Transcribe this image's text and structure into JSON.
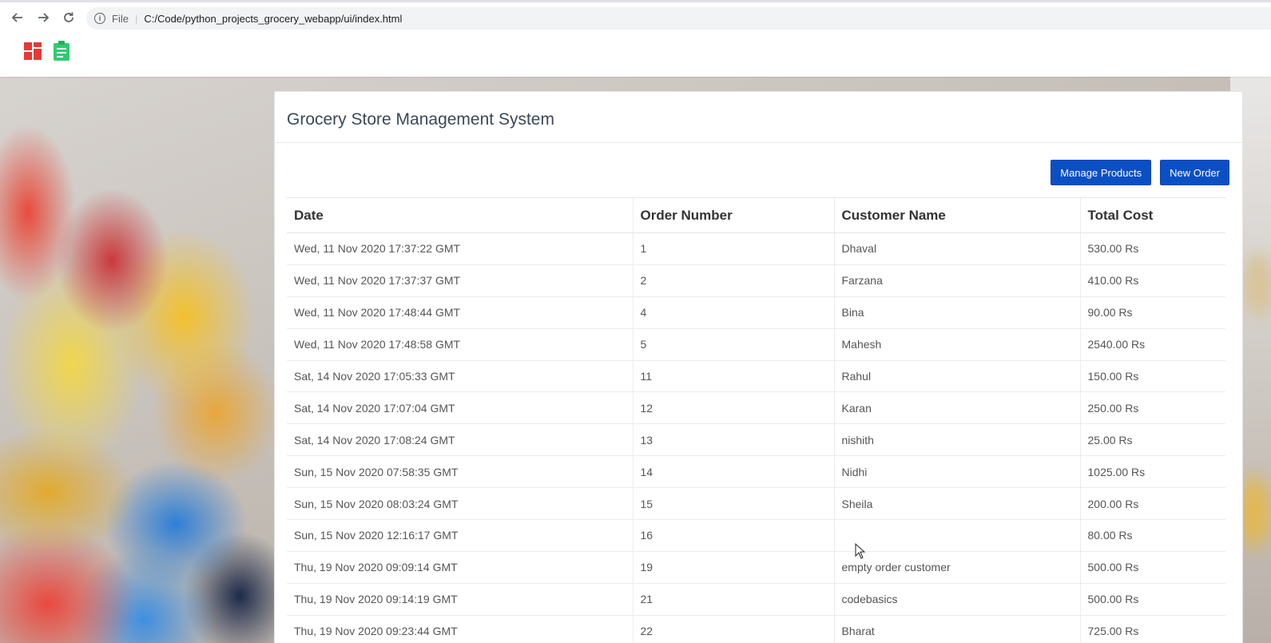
{
  "browser": {
    "scheme": "File",
    "url": "C:/Code/python_projects_grocery_webapp/ui/index.html"
  },
  "app": {
    "title": "Grocery Store Management System",
    "icons": [
      "dashboard-icon",
      "clipboard-icon"
    ],
    "colors": {
      "primary_button": "#0b4fc5",
      "dashboard_icon": "#e53935",
      "clipboard_icon": "#2ecc71"
    }
  },
  "actions": {
    "manage_products": "Manage Products",
    "new_order": "New Order"
  },
  "table": {
    "headers": [
      "Date",
      "Order Number",
      "Customer Name",
      "Total Cost"
    ],
    "rows": [
      [
        "Wed, 11 Nov 2020 17:37:22 GMT",
        "1",
        "Dhaval",
        "530.00 Rs"
      ],
      [
        "Wed, 11 Nov 2020 17:37:37 GMT",
        "2",
        "Farzana",
        "410.00 Rs"
      ],
      [
        "Wed, 11 Nov 2020 17:48:44 GMT",
        "4",
        "Bina",
        "90.00 Rs"
      ],
      [
        "Wed, 11 Nov 2020 17:48:58 GMT",
        "5",
        "Mahesh",
        "2540.00 Rs"
      ],
      [
        "Sat, 14 Nov 2020 17:05:33 GMT",
        "11",
        "Rahul",
        "150.00 Rs"
      ],
      [
        "Sat, 14 Nov 2020 17:07:04 GMT",
        "12",
        "Karan",
        "250.00 Rs"
      ],
      [
        "Sat, 14 Nov 2020 17:08:24 GMT",
        "13",
        "nishith",
        "25.00 Rs"
      ],
      [
        "Sun, 15 Nov 2020 07:58:35 GMT",
        "14",
        "Nidhi",
        "1025.00 Rs"
      ],
      [
        "Sun, 15 Nov 2020 08:03:24 GMT",
        "15",
        "Sheila",
        "200.00 Rs"
      ],
      [
        "Sun, 15 Nov 2020 12:16:17 GMT",
        "16",
        "",
        "80.00 Rs"
      ],
      [
        "Thu, 19 Nov 2020 09:09:14 GMT",
        "19",
        "empty order customer",
        "500.00 Rs"
      ],
      [
        "Thu, 19 Nov 2020 09:14:19 GMT",
        "21",
        "codebasics",
        "500.00 Rs"
      ],
      [
        "Thu, 19 Nov 2020 09:23:44 GMT",
        "22",
        "Bharat",
        "725.00 Rs"
      ]
    ]
  }
}
